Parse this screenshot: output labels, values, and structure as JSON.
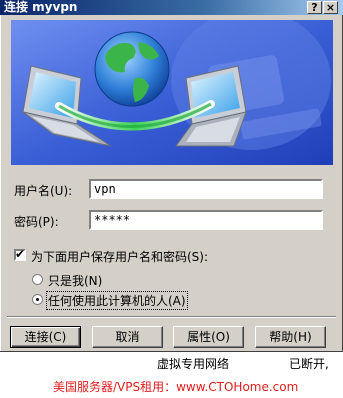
{
  "window": {
    "title": "连接 myvpn",
    "help_button": "?",
    "close_button": "×"
  },
  "form": {
    "username_label": "用户名(U):",
    "username_value": "vpn",
    "password_label": "密码(P):",
    "password_value": "*****",
    "save_checkbox_label": "为下面用户保存用户名和密码(S):",
    "save_checked": true,
    "radio_only_me": "只是我(N)",
    "radio_anyone": "任何使用此计算机的人(A)",
    "selected_radio": "anyone"
  },
  "buttons": {
    "connect": "连接(C)",
    "cancel": "取消",
    "properties": "属性(O)",
    "help": "帮助(H)"
  },
  "background": {
    "text_left": "虚拟专用网络",
    "text_right": "已断开,"
  },
  "watermark": {
    "text": "美国服务器/VPS租用：www.CTOHome.com"
  },
  "colors": {
    "titlebar_start": "#0a246a",
    "dialog_bg": "#d4d0c8",
    "banner_blue": "#3b5fd6",
    "watermark": "#e02020"
  },
  "icons": {
    "banner": "network-globe-laptops"
  }
}
